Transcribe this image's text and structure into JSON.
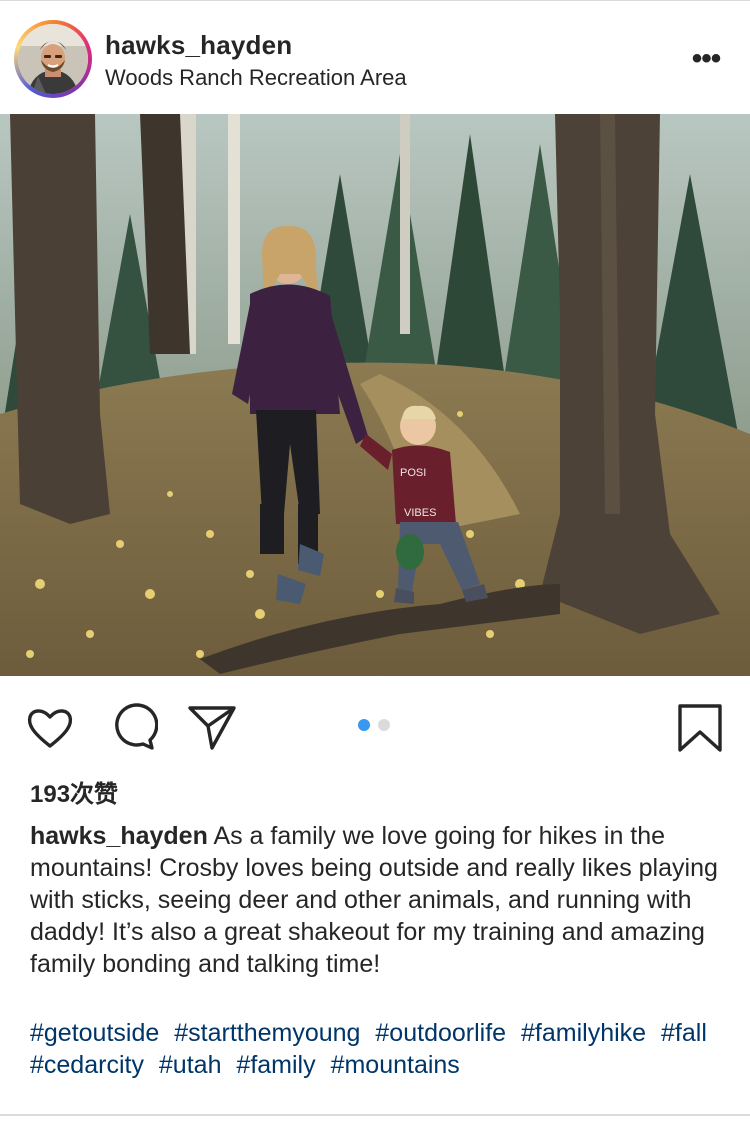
{
  "post": {
    "username": "hawks_hayden",
    "location": "Woods Ranch Recreation Area",
    "more_label": "•••"
  },
  "photo": {
    "carousel_count": 2,
    "active_index": 0
  },
  "actions": {
    "like_icon": "heart-icon",
    "comment_icon": "comment-icon",
    "share_icon": "send-icon",
    "save_icon": "bookmark-icon"
  },
  "likes": {
    "text": "193次赞"
  },
  "caption": {
    "username": "hawks_hayden",
    "text": "As a family we love going for hikes in the mountains! Crosby loves being outside and really likes playing with sticks, seeing deer and other animals, and running with daddy! It’s also a great shakeout for my training and amazing family bonding and talking time!"
  },
  "hashtags": [
    "#getoutside",
    "#startthemyoung",
    "#outdoorlife",
    "#familyhike",
    "#fall",
    "#cedarcity",
    "#utah",
    "#family",
    "#mountains"
  ],
  "colors": {
    "hashtag": "#003569",
    "active_dot": "#3897f0",
    "inactive_dot": "#dbdbdb",
    "text": "#262626"
  }
}
